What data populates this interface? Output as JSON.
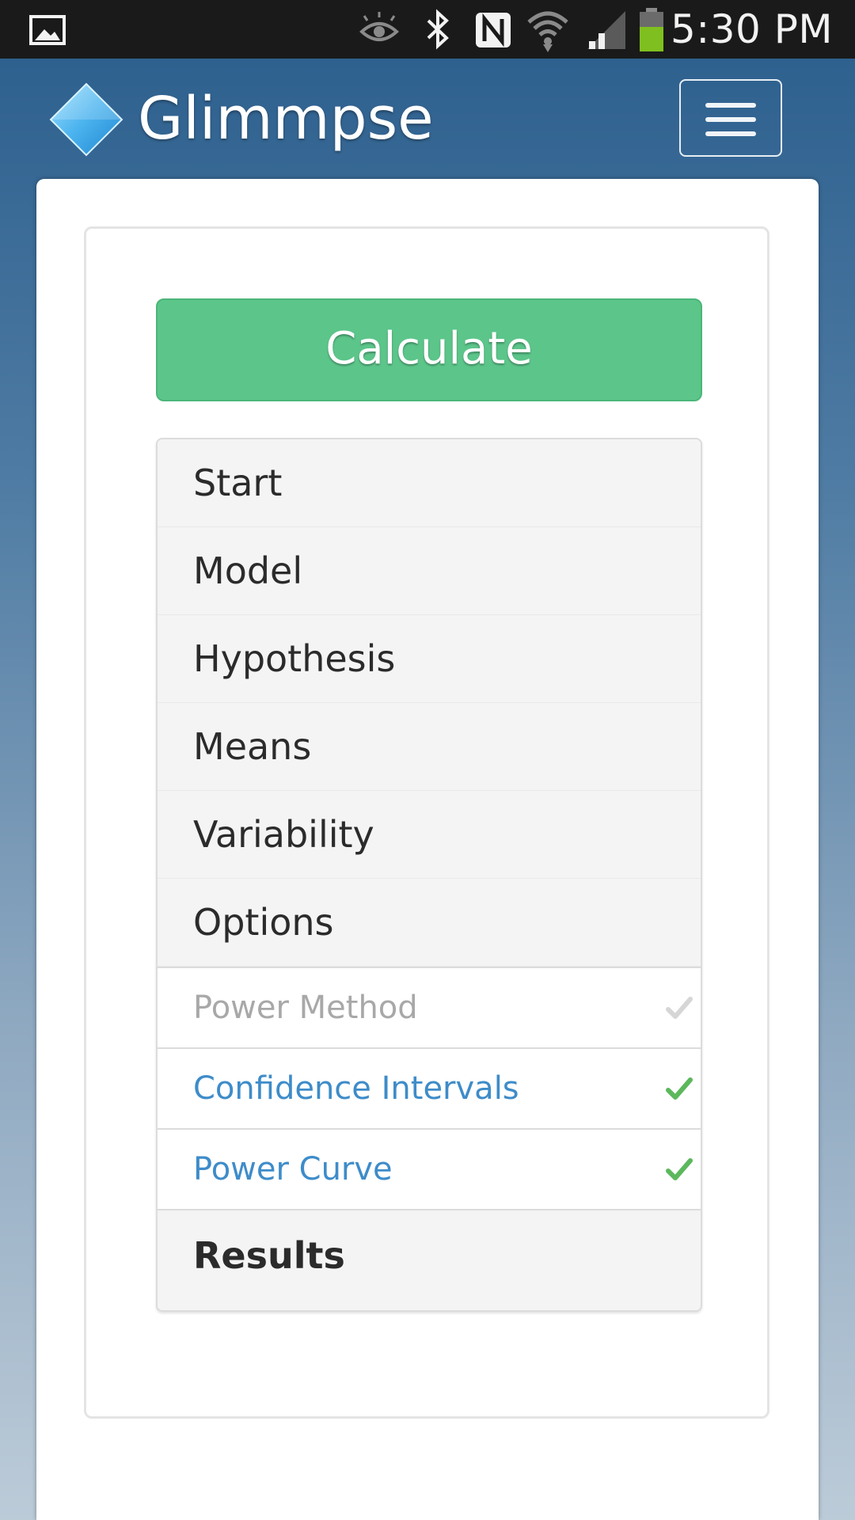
{
  "status_bar": {
    "time": "5:30 PM",
    "icons": [
      "image-icon",
      "eye-icon",
      "bluetooth-icon",
      "nfc-icon",
      "wifi-icon",
      "signal-icon",
      "battery-icon"
    ]
  },
  "navbar": {
    "brand": "Glimmpse",
    "logo_icon": "diamond-logo-icon",
    "menu_icon": "hamburger-menu-icon"
  },
  "main": {
    "calculate_label": "Calculate",
    "steps": [
      {
        "label": "Start"
      },
      {
        "label": "Model"
      },
      {
        "label": "Hypothesis"
      },
      {
        "label": "Means"
      },
      {
        "label": "Variability"
      },
      {
        "label": "Options"
      }
    ],
    "options_sub": [
      {
        "label": "Power Method",
        "state": "disabled",
        "check_color": "#d6d6d6"
      },
      {
        "label": "Confidence Intervals",
        "state": "active",
        "check_color": "#5cb85c"
      },
      {
        "label": "Power Curve",
        "state": "active",
        "check_color": "#5cb85c"
      }
    ],
    "results_label": "Results"
  },
  "colors": {
    "calculate_button": "#5cc58a",
    "link_blue": "#3e8cc9",
    "disabled_gray": "#a8a8a8"
  }
}
